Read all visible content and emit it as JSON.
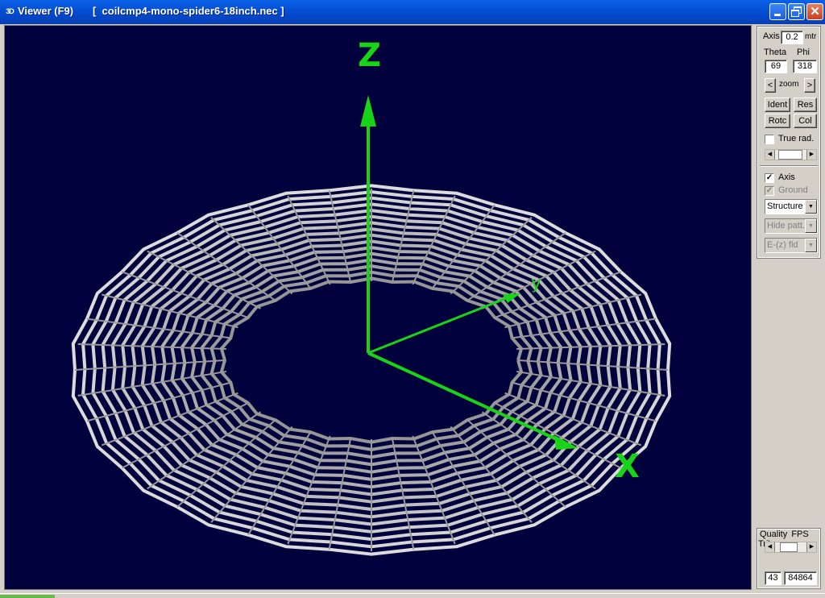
{
  "window": {
    "app_icon": "3D",
    "title": "Viewer (F9)",
    "file": "[  coilcmp4-mono-spider6-18inch.nec ]",
    "buttons": {
      "minimize": "minimize-icon",
      "maximize": "restore-icon",
      "close": "close-icon"
    }
  },
  "viewport": {
    "background": "#00003d",
    "axis_color": "#17d417",
    "structure_color": "#c8c8c8",
    "axis_labels": {
      "z": "Z",
      "y": "y",
      "x": "X"
    }
  },
  "panel": {
    "axis_label": "Axis",
    "axis_value": "0.2",
    "axis_unit": "mtr",
    "theta_label": "Theta",
    "phi_label": "Phi",
    "theta_value": "69",
    "phi_value": "318",
    "zoom_left": "<",
    "zoom_label": "zoom",
    "zoom_right": ">",
    "ident_label": "Ident",
    "res_label": "Res",
    "rotc_label": "Rotc",
    "col_label": "Col",
    "true_rad_label": "True rad.",
    "true_rad_checked": false,
    "axis_checkbox_label": "Axis",
    "axis_checked": true,
    "ground_label": "Ground",
    "ground_checked": true,
    "structure_select": "Structure",
    "hide_patt_select": "Hide patt.",
    "efield_select": "E-(z) fld"
  },
  "bottom_panel": {
    "quality_label": "Quality",
    "fps_label": "FPS",
    "tris_label": "Tri's",
    "fps_value": "43",
    "tris_value": "84864"
  }
}
